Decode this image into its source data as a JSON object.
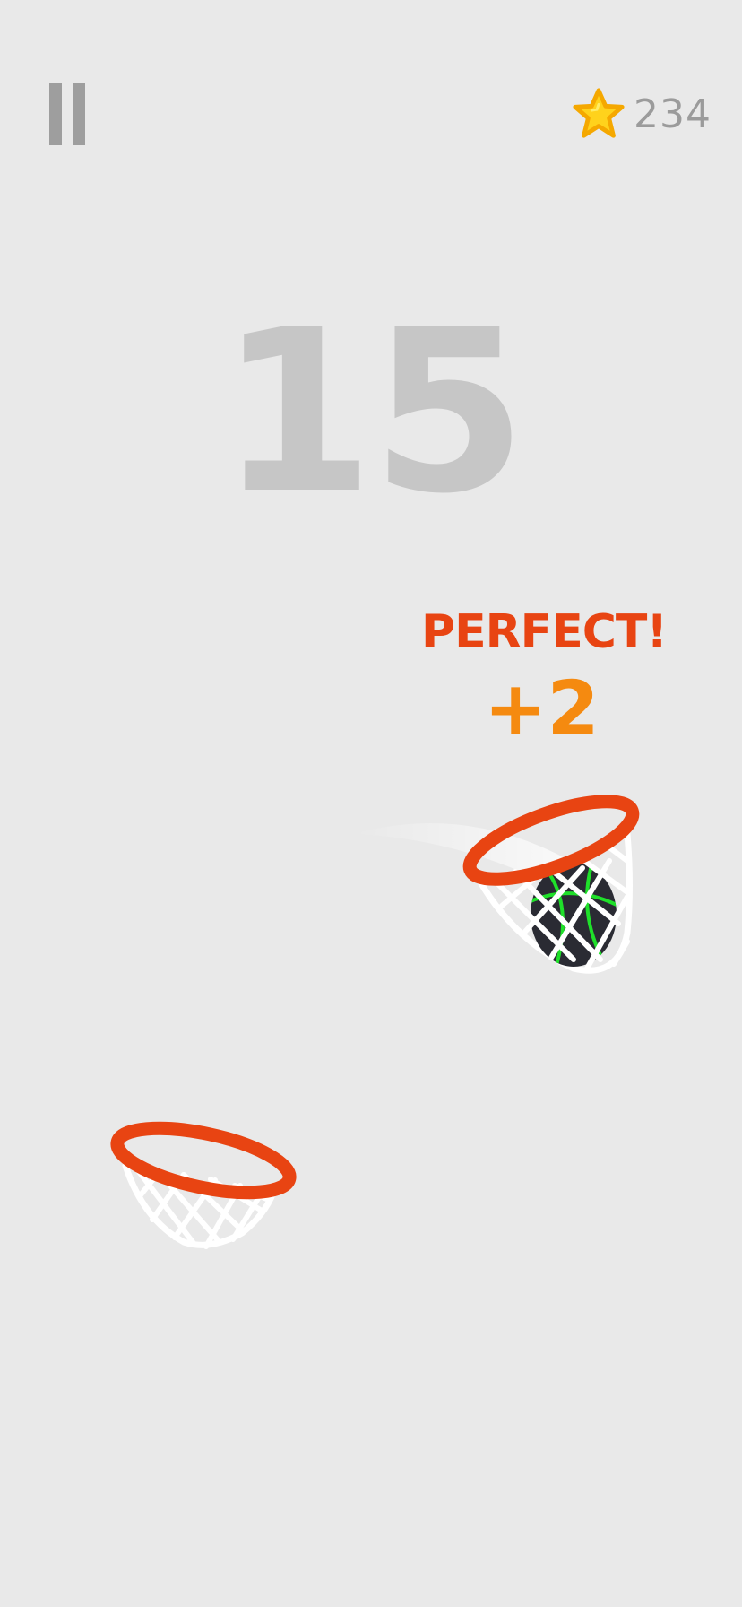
{
  "hud": {
    "pause_icon": "pause-icon",
    "star_icon": "star-icon",
    "star_count": "234"
  },
  "game": {
    "score": "15",
    "feedback": "PERFECT!",
    "bonus": "+2"
  },
  "colors": {
    "background": "#e9e9e9",
    "hoop_rim": "#e84412",
    "net": "#ffffff",
    "score_text": "#c6c6c6",
    "feedback_text": "#e84412",
    "bonus_text": "#f58a10",
    "star_fill": "#ffd21c",
    "star_outline": "#f5a800",
    "ball_body": "#2a2b33",
    "ball_glow": "#1fe02a"
  }
}
